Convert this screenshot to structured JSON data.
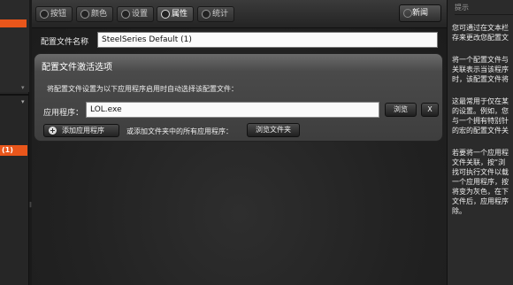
{
  "left_sidebar": {
    "selected_item_label": "(1)"
  },
  "toolbar": {
    "tabs": [
      {
        "label": "按钮"
      },
      {
        "label": "颜色"
      },
      {
        "label": "设置"
      },
      {
        "label": "属性"
      },
      {
        "label": "统计"
      }
    ],
    "new_label": "新闻"
  },
  "profile": {
    "name_label": "配置文件名称",
    "name_value": "SteelSeries Default (1)"
  },
  "activation": {
    "title": "配置文件激活选项",
    "description": "将配置文件设置为以下应用程序启用时自动选择该配置文件：",
    "app_label": "应用程序：",
    "app_value": "LOL.exe",
    "browse_label": "浏览",
    "remove_label": "X",
    "add_app_label": "添加应用程序",
    "or_text": "或添加文件夹中的所有应用程序：",
    "browse_folder_label": "浏览文件夹"
  },
  "hints": {
    "title": "提示",
    "paragraphs": [
      "您可通过在文本栏\n存来更改您配置文",
      "将一个配置文件与\n关联表示当该程序\n时，该配置文件将",
      "这最常用于仅在某\n的设置。例如，您\n与一个拥有特别针\n的宏的配置文件关",
      "若要将一个应用程\n文件关联，按“浏\n找可执行文件以载\n一个应用程序，按\n将变为灰色，在下\n文件后，应用程序\n除。"
    ]
  },
  "colors": {
    "accent": "#e9561b"
  }
}
